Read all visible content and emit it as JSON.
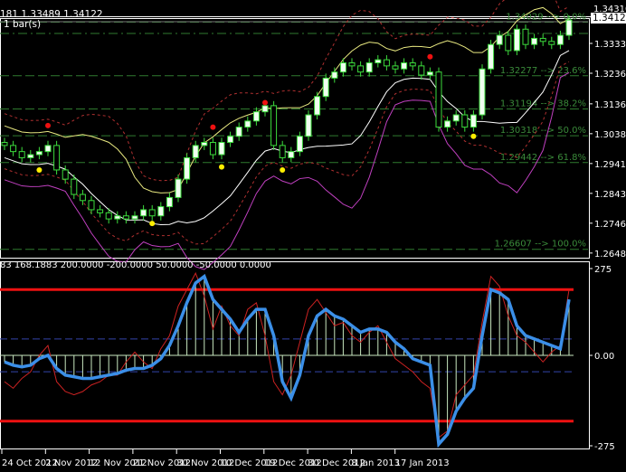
{
  "main": {
    "info_line": "181 1.33489 1.34122",
    "bars_info": "1 bar(s)",
    "current_price": "1.34122",
    "top_price_label": "1.34310",
    "price_labels": [
      {
        "text": "1.33335",
        "value": 1.33335
      },
      {
        "text": "1.32360",
        "value": 1.3236
      },
      {
        "text": "1.31360",
        "value": 1.3136
      },
      {
        "text": "1.30385",
        "value": 1.30385
      },
      {
        "text": "1.29410",
        "value": 1.2941
      },
      {
        "text": "1.28435",
        "value": 1.28435
      },
      {
        "text": "1.27460",
        "value": 1.2746
      },
      {
        "text": "1.26485",
        "value": 1.26485
      }
    ],
    "fib_levels": [
      {
        "text": "1.34029 --> 0.0%",
        "value": 1.34029
      },
      {
        "text": "1.32277 --> 23.6%",
        "value": 1.32277
      },
      {
        "text": "1.31194 --> 38.2%",
        "value": 1.31194
      },
      {
        "text": "1.30318 --> 50.0%",
        "value": 1.30318
      },
      {
        "text": "1.29442 --> 61.8%",
        "value": 1.29442
      },
      {
        "text": "1.26607 --> 100.0%",
        "value": 1.26607
      }
    ],
    "closes": [
      1.3,
      1.298,
      1.296,
      1.297,
      1.298,
      1.3,
      1.292,
      1.289,
      1.284,
      1.282,
      1.279,
      1.278,
      1.276,
      1.277,
      1.276,
      1.277,
      1.279,
      1.277,
      1.28,
      1.283,
      1.289,
      1.296,
      1.3,
      1.301,
      1.297,
      1.301,
      1.303,
      1.306,
      1.308,
      1.311,
      1.313,
      1.3,
      1.296,
      1.298,
      1.303,
      1.31,
      1.316,
      1.322,
      1.324,
      1.327,
      1.326,
      1.324,
      1.327,
      1.328,
      1.326,
      1.325,
      1.327,
      1.326,
      1.323,
      1.324,
      1.306,
      1.308,
      1.31,
      1.306,
      1.31,
      1.325,
      1.333,
      1.336,
      1.331,
      1.338,
      1.333,
      1.335,
      1.334,
      1.333,
      1.336,
      1.341
    ],
    "fractals_up": [
      [
        5,
        1.3065
      ],
      [
        24,
        1.306
      ],
      [
        30,
        1.314
      ],
      [
        49,
        1.329
      ]
    ],
    "fractals_down": [
      [
        4,
        1.292
      ],
      [
        17,
        1.2745
      ],
      [
        25,
        1.293
      ],
      [
        32,
        1.292
      ],
      [
        54,
        1.303
      ]
    ]
  },
  "indicator": {
    "info_line": "83 168.1883 200.0000 -200.0000 50.0000 -50.0000 0.0000",
    "scale_labels": [
      {
        "text": "275",
        "value": 275
      },
      {
        "text": "0.00",
        "value": 0
      },
      {
        "text": "-275",
        "value": -275
      }
    ],
    "levels": {
      "high": 200,
      "low": -200,
      "mid_high": 50,
      "mid_low": -50
    },
    "cci_smooth": [
      -20,
      -30,
      -35,
      -30,
      -10,
      0,
      -40,
      -60,
      -65,
      -70,
      -70,
      -65,
      -60,
      -55,
      -45,
      -40,
      -40,
      -30,
      -10,
      30,
      90,
      160,
      220,
      240,
      170,
      140,
      110,
      70,
      110,
      140,
      140,
      60,
      -80,
      -130,
      -60,
      60,
      120,
      140,
      120,
      110,
      90,
      70,
      80,
      80,
      70,
      40,
      20,
      -10,
      -20,
      -30,
      -270,
      -240,
      -170,
      -130,
      -100,
      60,
      200,
      190,
      170,
      90,
      60,
      50,
      40,
      30,
      20,
      170
    ],
    "cci_raw": [
      -80,
      -100,
      -70,
      -50,
      0,
      30,
      -80,
      -110,
      -120,
      -110,
      -90,
      -80,
      -60,
      -60,
      -20,
      10,
      -20,
      -40,
      20,
      60,
      150,
      200,
      250,
      180,
      80,
      150,
      90,
      60,
      140,
      160,
      60,
      -80,
      -120,
      -60,
      40,
      140,
      170,
      130,
      90,
      100,
      60,
      40,
      70,
      90,
      40,
      -10,
      -30,
      -50,
      -80,
      -100,
      -250,
      -230,
      -120,
      -90,
      -60,
      100,
      240,
      210,
      120,
      60,
      40,
      10,
      -20,
      10,
      30,
      200
    ],
    "colors": {
      "smooth": "#3b8fe8",
      "raw": "#cc2222",
      "level": "#ee1111",
      "dash": "#3344aa",
      "hist": "#c8e8c0"
    }
  },
  "time_axis": [
    "24 Oct 2012",
    "2 Nov 2012",
    "12 Nov 2012",
    "21 Nov 2012",
    "30 Nov 2012",
    "10 Dec 2012",
    "19 Dec 2012",
    "30 Dec 2012",
    "8 Jan 2013",
    "17 Jan 2013"
  ]
}
